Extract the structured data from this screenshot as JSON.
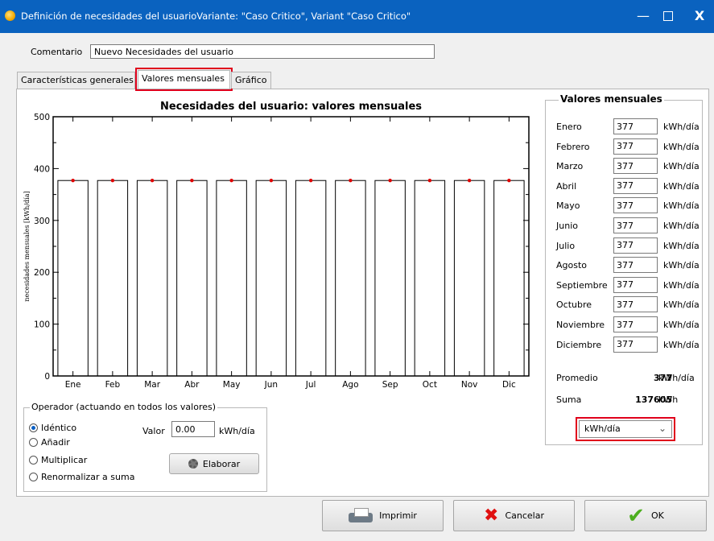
{
  "window": {
    "title": "Definición de necesidades del usuarioVariante:  \"Caso Critico\", Variant  \"Caso Critico\"",
    "minimize": "—",
    "close": "X"
  },
  "comment": {
    "label": "Comentario",
    "value": "Nuevo Necesidades del usuario"
  },
  "tabs": [
    {
      "label": "Características generales"
    },
    {
      "label": "Valores mensuales"
    },
    {
      "label": "Gráfico"
    }
  ],
  "chart_data": {
    "type": "bar",
    "title": "Necesidades del usuario: valores mensuales",
    "ylabel": "necesidades mensuales [kWh/día]",
    "xlabel": "",
    "categories": [
      "Ene",
      "Feb",
      "Mar",
      "Abr",
      "May",
      "Jun",
      "Jul",
      "Ago",
      "Sep",
      "Oct",
      "Nov",
      "Dic"
    ],
    "values": [
      377,
      377,
      377,
      377,
      377,
      377,
      377,
      377,
      377,
      377,
      377,
      377
    ],
    "ylim": [
      0,
      500
    ],
    "yticks": [
      0,
      100,
      200,
      300,
      400,
      500
    ],
    "marker_color": "#e00000"
  },
  "operator": {
    "legend": "Operador (actuando en todos los valores)",
    "options": [
      {
        "label": "Idéntico",
        "selected": true
      },
      {
        "label": "Añadir",
        "selected": false
      },
      {
        "label": "Multiplicar",
        "selected": false
      },
      {
        "label": "Renormalizar a suma",
        "selected": false
      }
    ],
    "valor_label": "Valor",
    "valor_value": "0.00",
    "valor_unit": "kWh/día",
    "elaborar_label": "Elaborar"
  },
  "monthly": {
    "legend": "Valores mensuales",
    "unit": "kWh/día",
    "months": [
      {
        "name": "Enero",
        "value": "377"
      },
      {
        "name": "Febrero",
        "value": "377"
      },
      {
        "name": "Marzo",
        "value": "377"
      },
      {
        "name": "Abril",
        "value": "377"
      },
      {
        "name": "Mayo",
        "value": "377"
      },
      {
        "name": "Junio",
        "value": "377"
      },
      {
        "name": "Julio",
        "value": "377"
      },
      {
        "name": "Agosto",
        "value": "377"
      },
      {
        "name": "Septiembre",
        "value": "377"
      },
      {
        "name": "Octubre",
        "value": "377"
      },
      {
        "name": "Noviembre",
        "value": "377"
      },
      {
        "name": "Diciembre",
        "value": "377"
      }
    ],
    "promedio_label": "Promedio",
    "promedio_value": "377",
    "promedio_unit": "kWh/día",
    "suma_label": "Suma",
    "suma_value": "137605",
    "suma_unit": "kWh",
    "unit_select": "kWh/día"
  },
  "buttons": {
    "print": "Imprimir",
    "cancel": "Cancelar",
    "ok": "OK"
  },
  "icons": {
    "app": "pvsyst-sun-icon",
    "print": "printer-icon",
    "cancel": "red-x-icon",
    "ok": "green-check-icon",
    "elaborar": "gear-icon"
  },
  "colors": {
    "titlebar": "#0a62bf",
    "highlight": "#e0001b"
  }
}
